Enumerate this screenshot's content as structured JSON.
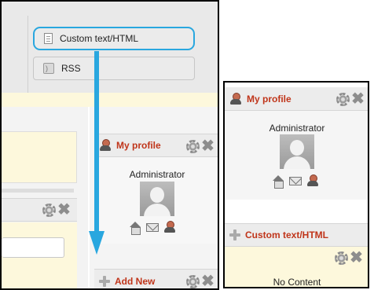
{
  "widget_menu": {
    "custom_text_html": "Custom text/HTML",
    "rss": "RSS"
  },
  "left_panel": {
    "my_profile_title": "My profile",
    "admin_name": "Administrator",
    "add_new_title": "Add New"
  },
  "right_panel": {
    "my_profile_title": "My profile",
    "admin_name": "Administrator",
    "custom_text_title": "Custom text/HTML",
    "no_content": "No Content"
  },
  "colors": {
    "highlight_blue": "#29a7df",
    "widget_title_red": "#c0351a",
    "cream": "#fdf8dc"
  }
}
